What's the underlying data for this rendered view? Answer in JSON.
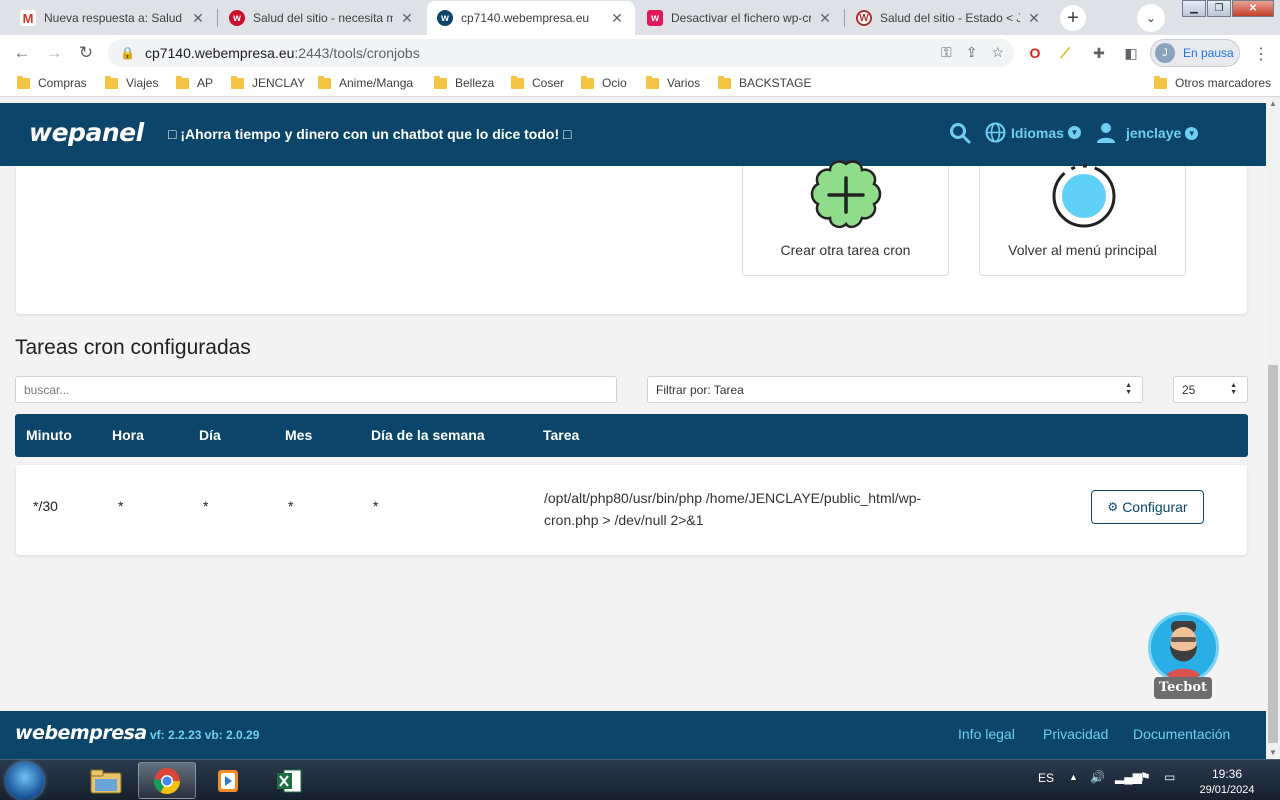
{
  "browser": {
    "tabs": [
      {
        "title": "Nueva respuesta a: Salud del",
        "icon": "gmail-icon"
      },
      {
        "title": "Salud del sitio - necesita me",
        "icon": "webempresa-icon"
      },
      {
        "title": "cp7140.webempresa.eu",
        "icon": "wepanel-icon",
        "active": true
      },
      {
        "title": "Desactivar el fichero wp-cro",
        "icon": "webempresa-icon"
      },
      {
        "title": "Salud del sitio - Estado < Je",
        "icon": "wordpress-icon"
      }
    ],
    "url_host": "cp7140.webempresa.eu",
    "url_path": ":2443/tools/cronjobs",
    "profile_label": "En pausa",
    "profile_initial": "J",
    "bookmarks": [
      "Compras",
      "Viajes",
      "AP",
      "JENCLAY",
      "Anime/Manga",
      "Belleza",
      "Coser",
      "Ocio",
      "Varios",
      "BACKSTAGE"
    ],
    "other_bookmarks": "Otros marcadores"
  },
  "header": {
    "logo": "wepanel",
    "promo": "□ ¡Ahorra tiempo y dinero con un chatbot que lo dice todo! □",
    "languages": "Idiomas",
    "user": "jenclaye"
  },
  "actions": {
    "create_label": "Crear otra tarea cron",
    "back_label": "Volver al menú principal"
  },
  "cron": {
    "title": "Tareas cron configuradas",
    "search_placeholder": "buscar...",
    "filter_label": "Filtrar por: Tarea",
    "page_size": "25",
    "columns": [
      "Minuto",
      "Hora",
      "Día",
      "Mes",
      "Día de la semana",
      "Tarea"
    ],
    "rows": [
      {
        "minute": "*/30",
        "hour": "*",
        "day": "*",
        "month": "*",
        "weekday": "*",
        "task_line1": "/opt/alt/php80/usr/bin/php /home/JENCLAYE/public_html/wp-",
        "task_line2": "cron.php > /dev/null 2>&1",
        "button": "Configurar"
      }
    ]
  },
  "assistant": {
    "name": "Tecbot"
  },
  "footer": {
    "logo": "webempresa",
    "version": "vf: 2.2.23  vb: 2.0.29",
    "links": [
      "Info legal",
      "Privacidad",
      "Documentación"
    ]
  },
  "taskbar": {
    "lang": "ES",
    "time": "19:36",
    "date": "29/01/2024"
  },
  "colors": {
    "brand_dark": "#0b4569",
    "accent_cyan": "#6fcff0",
    "green_add": "#8fdc8b",
    "cyan_circle": "#5fd1f7"
  }
}
